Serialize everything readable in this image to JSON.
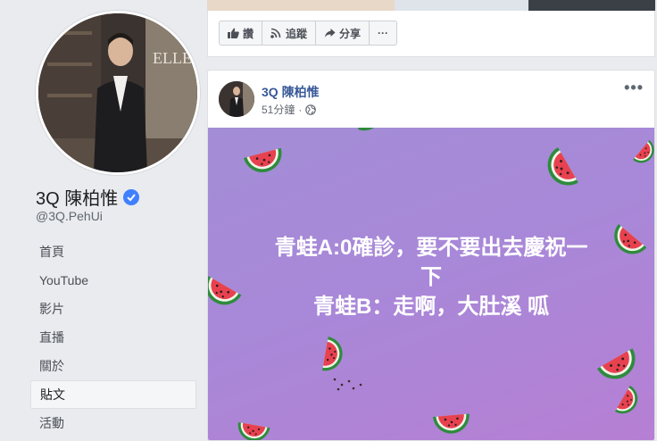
{
  "profile": {
    "name": "3Q 陳柏惟",
    "handle": "@3Q.PehUi"
  },
  "nav": {
    "items": [
      "首頁",
      "YouTube",
      "影片",
      "直播",
      "關於",
      "貼文",
      "活動"
    ],
    "active_index": 5
  },
  "toolbar": {
    "like_label": "讚",
    "follow_label": "追蹤",
    "share_label": "分享",
    "more_label": "···"
  },
  "post": {
    "author": "3Q 陳柏惟",
    "time": "51分鐘",
    "separator": "·",
    "menu_label": "•••",
    "text_lines": [
      "青蛙A:0確診，要不要出去慶祝一",
      "下",
      "青蛙B：走啊，大肚溪 呱"
    ]
  },
  "colors": {
    "link": "#385898",
    "verified": "#4080ff",
    "image_bg": "#a68bd7"
  }
}
